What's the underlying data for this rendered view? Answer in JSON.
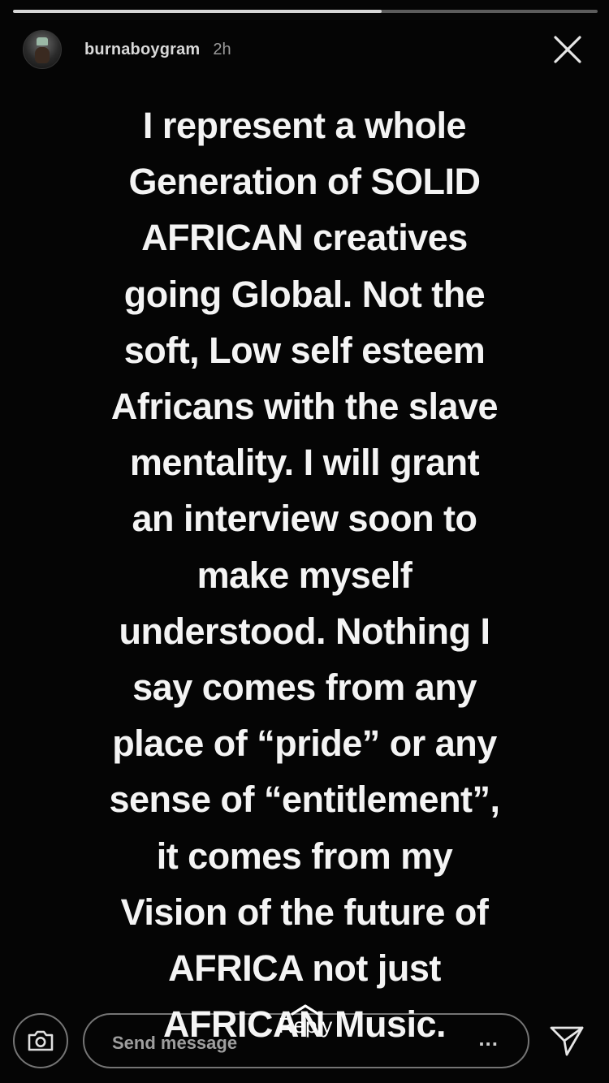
{
  "progress": {
    "fraction": 0.63
  },
  "header": {
    "username": "burnaboygram",
    "time": "2h",
    "avatar_icon": "profile-avatar",
    "close_icon": "close-icon"
  },
  "story": {
    "lines": [
      "I represent a whole",
      "Generation of SOLID",
      "AFRICAN creatives",
      "going Global.  Not the",
      "soft, Low self esteem",
      "Africans with the slave",
      "mentality.  I will grant",
      "an interview soon to",
      "make myself",
      "understood. Nothing I",
      "say comes from any",
      "place of “pride” or any",
      "sense of “entitlement”,",
      "it comes from my",
      "Vision of the future of",
      "AFRICA not just",
      "AFRICAN Music."
    ]
  },
  "footer": {
    "camera_icon": "camera-icon",
    "message_placeholder": "Send message",
    "more_label": "...",
    "reply_label": "Reply",
    "send_icon": "send-icon"
  }
}
